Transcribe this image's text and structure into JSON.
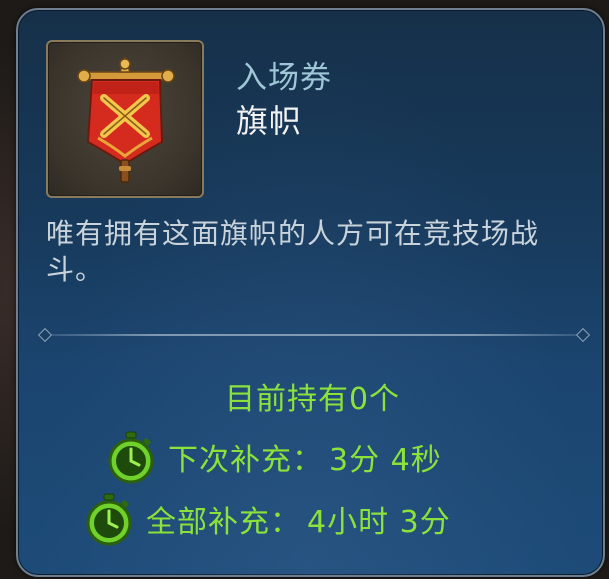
{
  "item": {
    "type_label": "入场券",
    "name": "旗帜",
    "icon": "red-banner-crossed-swords-icon",
    "description": "唯有拥有这面旗帜的人方可在竞技场战斗。"
  },
  "stock": {
    "holding_text": "目前持有0个"
  },
  "timers": {
    "next": {
      "label": "下次补充：",
      "value": "3分 4秒",
      "icon": "stopwatch-icon"
    },
    "full": {
      "label": "全部补充：",
      "value": "4小时 3分",
      "icon": "stopwatch-icon"
    }
  },
  "colors": {
    "accent_green": "#8be33a",
    "type_label": "#9ec6d6",
    "panel_blue": "#1b4570"
  }
}
